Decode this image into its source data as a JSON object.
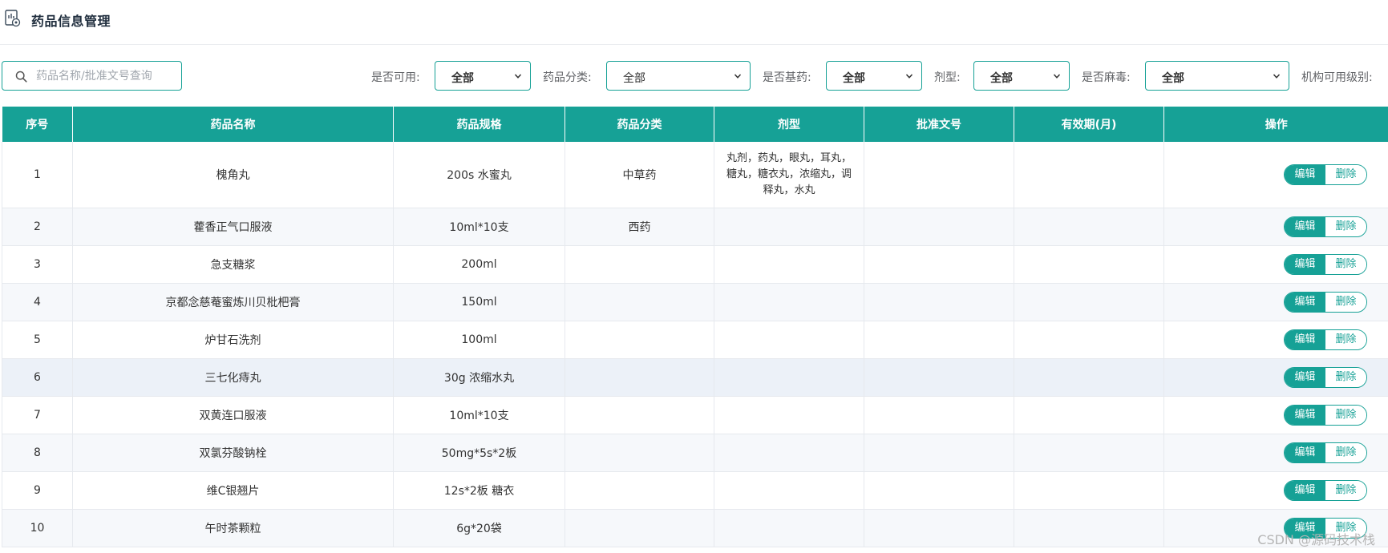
{
  "header": {
    "title": "药品信息管理",
    "icon": "chart-document-icon"
  },
  "search": {
    "placeholder": "药品名称/批准文号查询",
    "value": ""
  },
  "filters": [
    {
      "label": "是否可用:",
      "value": "全部"
    },
    {
      "label": "药品分类:",
      "value": "全部"
    },
    {
      "label": "是否基药:",
      "value": "全部"
    },
    {
      "label": "剂型:",
      "value": "全部"
    },
    {
      "label": "是否麻毒:",
      "value": "全部"
    },
    {
      "label": "机构可用级别:",
      "value": ""
    }
  ],
  "table": {
    "columns": [
      "序号",
      "药品名称",
      "药品规格",
      "药品分类",
      "剂型",
      "批准文号",
      "有效期(月)",
      "操作"
    ],
    "rows": [
      {
        "index": "1",
        "name": "槐角丸",
        "spec": "200s 水蜜丸",
        "category": "中草药",
        "dosage": "丸剂，药丸，眼丸，耳丸，糖丸，糖衣丸，浓缩丸，调释丸，水丸",
        "approval": "",
        "validity": ""
      },
      {
        "index": "2",
        "name": "藿香正气口服液",
        "spec": "10ml*10支",
        "category": "西药",
        "dosage": "",
        "approval": "",
        "validity": ""
      },
      {
        "index": "3",
        "name": "急支糖浆",
        "spec": "200ml",
        "category": "",
        "dosage": "",
        "approval": "",
        "validity": ""
      },
      {
        "index": "4",
        "name": "京都念慈菴蜜炼川贝枇杷膏",
        "spec": "150ml",
        "category": "",
        "dosage": "",
        "approval": "",
        "validity": ""
      },
      {
        "index": "5",
        "name": "炉甘石洗剂",
        "spec": "100ml",
        "category": "",
        "dosage": "",
        "approval": "",
        "validity": ""
      },
      {
        "index": "6",
        "name": "三七化痔丸",
        "spec": "30g 浓缩水丸",
        "category": "",
        "dosage": "",
        "approval": "",
        "validity": ""
      },
      {
        "index": "7",
        "name": "双黄连口服液",
        "spec": "10ml*10支",
        "category": "",
        "dosage": "",
        "approval": "",
        "validity": ""
      },
      {
        "index": "8",
        "name": "双氯芬酸钠栓",
        "spec": "50mg*5s*2板",
        "category": "",
        "dosage": "",
        "approval": "",
        "validity": ""
      },
      {
        "index": "9",
        "name": "维C银翘片",
        "spec": "12s*2板 糖衣",
        "category": "",
        "dosage": "",
        "approval": "",
        "validity": ""
      },
      {
        "index": "10",
        "name": "午时茶颗粒",
        "spec": "6g*20袋",
        "category": "",
        "dosage": "",
        "approval": "",
        "validity": ""
      }
    ],
    "actions": {
      "edit": "编辑",
      "delete": "删除"
    }
  },
  "watermark": "CSDN @源码技术栈",
  "colors": {
    "accent": "#16a196",
    "header_text": "#ffffff",
    "row_alt": "#f6f8fb",
    "row_highlight": "#ecf1f8"
  }
}
